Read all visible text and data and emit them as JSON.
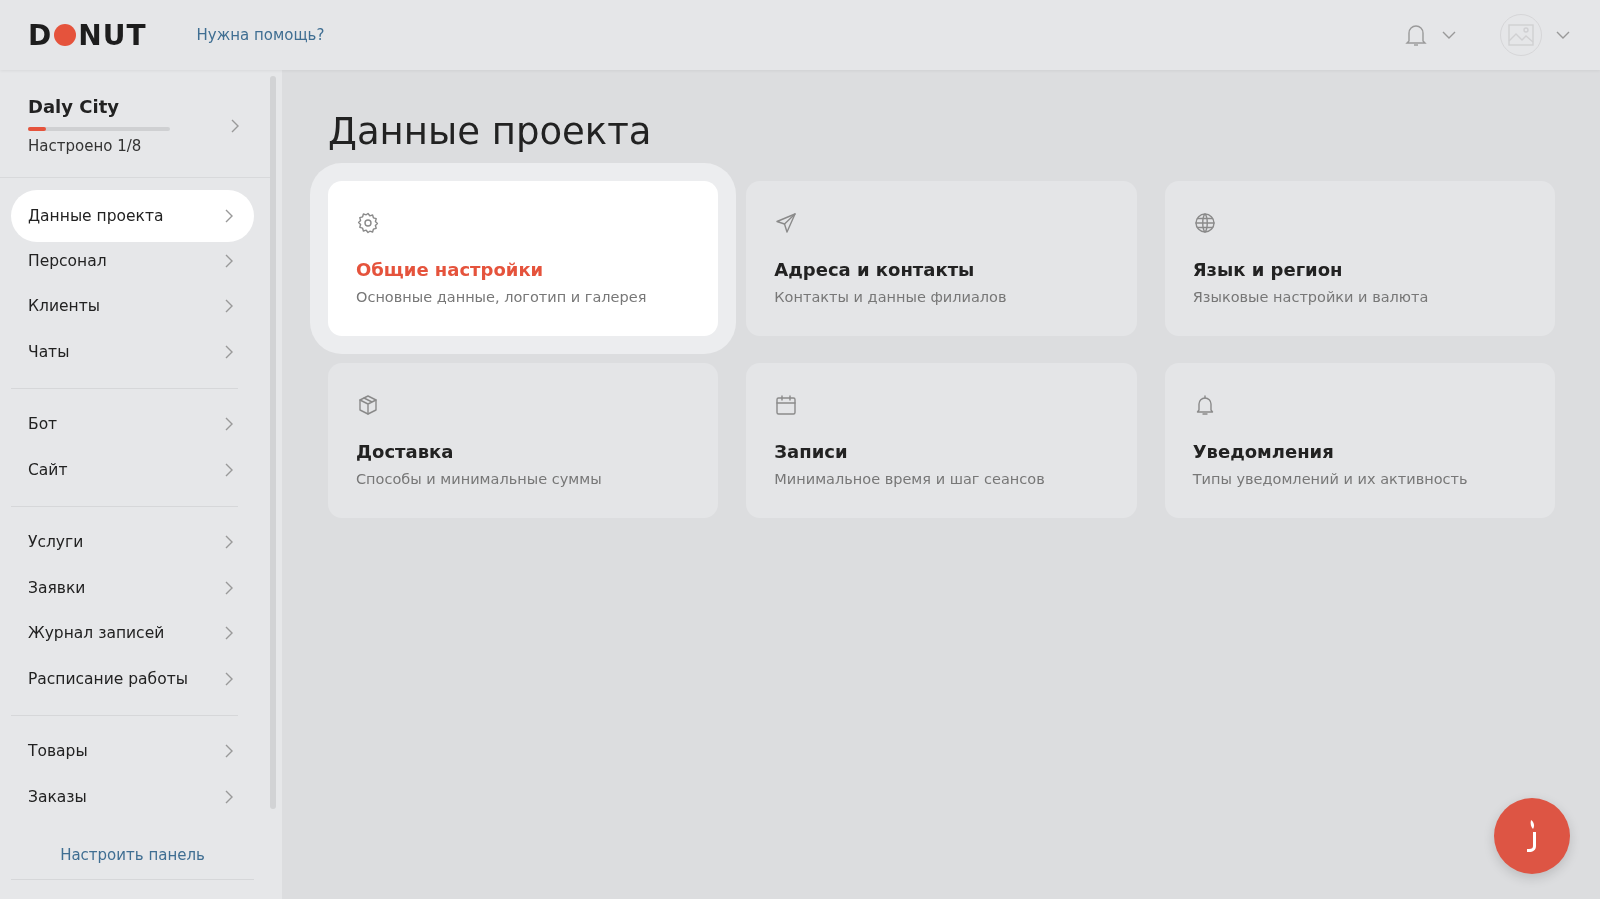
{
  "header": {
    "logo": {
      "before": "D",
      "after": "NUT"
    },
    "help_link": "Нужна помощь?"
  },
  "sidebar": {
    "project": {
      "name": "Daly City",
      "level": 0.125,
      "progress_text": "Настроено 1/8"
    },
    "groups": [
      [
        {
          "label": "Данные проекта",
          "selected": true
        },
        {
          "label": "Персонал",
          "selected": false
        },
        {
          "label": "Клиенты",
          "selected": false
        },
        {
          "label": "Чаты",
          "selected": false
        }
      ],
      [
        {
          "label": "Бот",
          "selected": false
        },
        {
          "label": "Сайт",
          "selected": false
        }
      ],
      [
        {
          "label": "Услуги",
          "selected": false
        },
        {
          "label": "Заявки",
          "selected": false
        },
        {
          "label": "Журнал записей",
          "selected": false
        },
        {
          "label": "Расписание работы",
          "selected": false
        }
      ],
      [
        {
          "label": "Товары",
          "selected": false
        },
        {
          "label": "Заказы",
          "selected": false
        }
      ]
    ],
    "customize_link": "Настроить панель"
  },
  "page": {
    "title": "Данные проекта",
    "cards": [
      {
        "kind": "general",
        "title": "Общие настройки",
        "subtitle": "Основные данные, логотип и галерея",
        "selected": true
      },
      {
        "kind": "contacts",
        "title": "Адреса и контакты",
        "subtitle": "Контакты и данные филиалов",
        "selected": false
      },
      {
        "kind": "locale",
        "title": "Язык и регион",
        "subtitle": "Языковые настройки и валюта",
        "selected": false
      },
      {
        "kind": "delivery",
        "title": "Доставка",
        "subtitle": "Способы и минимальные суммы",
        "selected": false
      },
      {
        "kind": "bookings",
        "title": "Записи",
        "subtitle": "Минимальное время и шаг сеансов",
        "selected": false
      },
      {
        "kind": "notifications",
        "title": "Уведомления",
        "subtitle": "Типы уведомлений и их активность",
        "selected": false
      }
    ]
  }
}
